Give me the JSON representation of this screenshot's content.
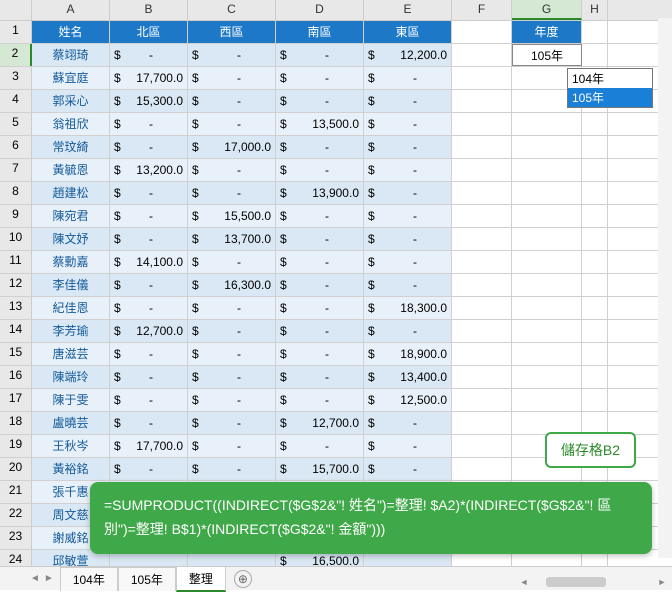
{
  "columns": [
    "A",
    "B",
    "C",
    "D",
    "E",
    "F",
    "G",
    "H"
  ],
  "headerRow": {
    "A": "姓名",
    "B": "北區",
    "C": "西區",
    "D": "南區",
    "E": "東區",
    "G": "年度"
  },
  "yearCell": {
    "value": "105年",
    "options": [
      "104年",
      "105年"
    ],
    "selected": "105年"
  },
  "rows": [
    {
      "n": 2,
      "name": "蔡翊琦",
      "b": [
        "-",
        ""
      ],
      "c": [
        "-",
        ""
      ],
      "d": [
        "-",
        ""
      ],
      "e": [
        "12,200.0",
        ""
      ]
    },
    {
      "n": 3,
      "name": "蘇宜庭",
      "b": [
        "17,700.0",
        ""
      ],
      "c": [
        "-",
        ""
      ],
      "d": [
        "-",
        ""
      ],
      "e": [
        "-",
        ""
      ]
    },
    {
      "n": 4,
      "name": "郭采心",
      "b": [
        "15,300.0",
        ""
      ],
      "c": [
        "-",
        ""
      ],
      "d": [
        "-",
        ""
      ],
      "e": [
        "-",
        ""
      ]
    },
    {
      "n": 5,
      "name": "翁祖欣",
      "b": [
        "-",
        ""
      ],
      "c": [
        "-",
        ""
      ],
      "d": [
        "13,500.0",
        ""
      ],
      "e": [
        "-",
        ""
      ]
    },
    {
      "n": 6,
      "name": "常玟綺",
      "b": [
        "-",
        ""
      ],
      "c": [
        "17,000.0",
        ""
      ],
      "d": [
        "-",
        ""
      ],
      "e": [
        "-",
        ""
      ]
    },
    {
      "n": 7,
      "name": "黃毓恩",
      "b": [
        "13,200.0",
        ""
      ],
      "c": [
        "-",
        ""
      ],
      "d": [
        "-",
        ""
      ],
      "e": [
        "-",
        ""
      ]
    },
    {
      "n": 8,
      "name": "趙建松",
      "b": [
        "-",
        ""
      ],
      "c": [
        "-",
        ""
      ],
      "d": [
        "13,900.0",
        ""
      ],
      "e": [
        "-",
        ""
      ]
    },
    {
      "n": 9,
      "name": "陳宛君",
      "b": [
        "-",
        ""
      ],
      "c": [
        "15,500.0",
        ""
      ],
      "d": [
        "-",
        ""
      ],
      "e": [
        "-",
        ""
      ]
    },
    {
      "n": 10,
      "name": "陳文妤",
      "b": [
        "-",
        ""
      ],
      "c": [
        "13,700.0",
        ""
      ],
      "d": [
        "-",
        ""
      ],
      "e": [
        "-",
        ""
      ]
    },
    {
      "n": 11,
      "name": "蔡勳嘉",
      "b": [
        "14,100.0",
        ""
      ],
      "c": [
        "-",
        ""
      ],
      "d": [
        "-",
        ""
      ],
      "e": [
        "-",
        ""
      ]
    },
    {
      "n": 12,
      "name": "李佳儀",
      "b": [
        "-",
        ""
      ],
      "c": [
        "16,300.0",
        ""
      ],
      "d": [
        "-",
        ""
      ],
      "e": [
        "-",
        ""
      ]
    },
    {
      "n": 13,
      "name": "紀佳恩",
      "b": [
        "-",
        ""
      ],
      "c": [
        "-",
        ""
      ],
      "d": [
        "-",
        ""
      ],
      "e": [
        "18,300.0",
        ""
      ]
    },
    {
      "n": 14,
      "name": "李芳瑜",
      "b": [
        "12,700.0",
        ""
      ],
      "c": [
        "-",
        ""
      ],
      "d": [
        "-",
        ""
      ],
      "e": [
        "-",
        ""
      ]
    },
    {
      "n": 15,
      "name": "唐滋芸",
      "b": [
        "-",
        ""
      ],
      "c": [
        "-",
        ""
      ],
      "d": [
        "-",
        ""
      ],
      "e": [
        "18,900.0",
        ""
      ]
    },
    {
      "n": 16,
      "name": "陳端玲",
      "b": [
        "-",
        ""
      ],
      "c": [
        "-",
        ""
      ],
      "d": [
        "-",
        ""
      ],
      "e": [
        "13,400.0",
        ""
      ]
    },
    {
      "n": 17,
      "name": "陳于雯",
      "b": [
        "-",
        ""
      ],
      "c": [
        "-",
        ""
      ],
      "d": [
        "-",
        ""
      ],
      "e": [
        "12,500.0",
        ""
      ]
    },
    {
      "n": 18,
      "name": "盧曉芸",
      "b": [
        "-",
        ""
      ],
      "c": [
        "-",
        ""
      ],
      "d": [
        "12,700.0",
        ""
      ],
      "e": [
        "-",
        ""
      ]
    },
    {
      "n": 19,
      "name": "王秋岑",
      "b": [
        "17,700.0",
        ""
      ],
      "c": [
        "-",
        ""
      ],
      "d": [
        "-",
        ""
      ],
      "e": [
        "-",
        ""
      ]
    },
    {
      "n": 20,
      "name": "黃裕銘",
      "b": [
        "-",
        ""
      ],
      "c": [
        "-",
        ""
      ],
      "d": [
        "15,700.0",
        ""
      ],
      "e": [
        "-",
        ""
      ]
    },
    {
      "n": 21,
      "name": "張千惠",
      "b": [
        "",
        ""
      ],
      "c": [
        "",
        ""
      ],
      "d": [
        "",
        ""
      ],
      "e": [
        "",
        ""
      ]
    },
    {
      "n": 22,
      "name": "周文慈",
      "b": [
        "",
        ""
      ],
      "c": [
        "",
        ""
      ],
      "d": [
        "",
        ""
      ],
      "e": [
        "",
        ""
      ]
    },
    {
      "n": 23,
      "name": "謝威銘",
      "b": [
        "",
        ""
      ],
      "c": [
        "",
        ""
      ],
      "d": [
        "",
        ""
      ],
      "e": [
        "",
        ""
      ]
    },
    {
      "n": 24,
      "name": "邱敏萱",
      "b": [
        "",
        ""
      ],
      "c": [
        "",
        ""
      ],
      "d": [
        "16,500.0",
        ""
      ],
      "e": [
        "",
        ""
      ]
    }
  ],
  "tabs": {
    "items": [
      "104年",
      "105年",
      "整理"
    ],
    "active": "整理"
  },
  "formulaBadge": "儲存格B2",
  "formula": "=SUMPRODUCT((INDIRECT($G$2&\"! 姓名\")=整理! $A2)*(INDIRECT($G$2&\"! 區別\")=整理! B$1)*(INDIRECT($G$2&\"! 金額\")))",
  "currency": "$"
}
